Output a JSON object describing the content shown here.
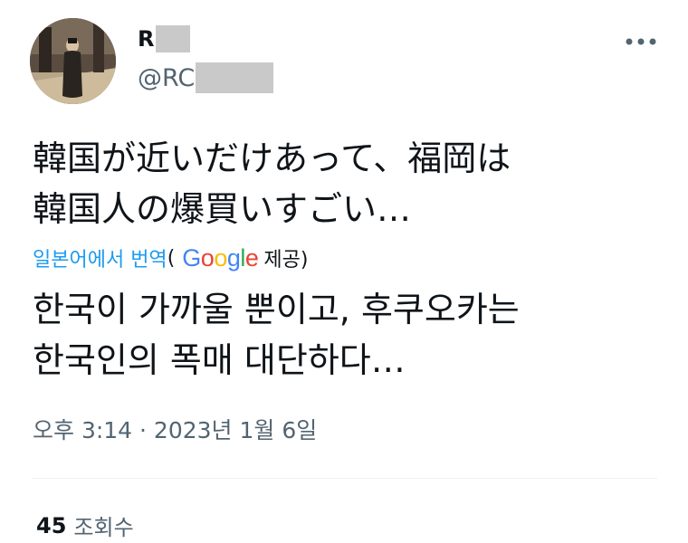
{
  "author": {
    "display_name": "R",
    "handle": "@RC"
  },
  "menu": {
    "more_icon": "more-horizontal-icon"
  },
  "tweet": {
    "text_line1": "韓国が近いだけあって、福岡は",
    "text_line2": "韓国人の爆買いすごい…",
    "translate_label": "일본어에서 번역",
    "translate_open": "(",
    "google_g": "G",
    "google_o1": "o",
    "google_o2": "o",
    "google_g2": "g",
    "google_l": "l",
    "google_e": "e",
    "translate_provided": "제공)",
    "translated_line1": "한국이 가까울 뿐이고, 후쿠오카는",
    "translated_line2": "한국인의 폭매 대단하다…",
    "timestamp": "오후 3:14 · 2023년 1월 6일"
  },
  "stats": {
    "views_count": "45",
    "views_label": "조회수"
  },
  "colors": {
    "accent": "#1d9bf0",
    "text": "#0f1419",
    "secondary": "#536471",
    "redaction": "#c9c9c9"
  }
}
